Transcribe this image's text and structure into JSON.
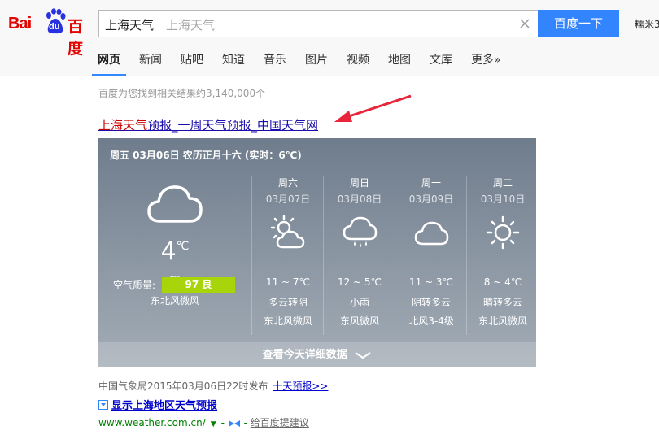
{
  "header": {
    "logo_left": "Bai",
    "logo_du": "du",
    "logo_cn": "百度",
    "search_value": "上海天气",
    "search_suggest": "上海天气",
    "search_button": "百度一下",
    "user_link": "糯米3"
  },
  "nav": [
    {
      "label": "网页",
      "active": true
    },
    {
      "label": "新闻"
    },
    {
      "label": "贴吧"
    },
    {
      "label": "知道"
    },
    {
      "label": "音乐"
    },
    {
      "label": "图片"
    },
    {
      "label": "视频"
    },
    {
      "label": "地图"
    },
    {
      "label": "文库"
    },
    {
      "label": "更多»"
    }
  ],
  "result_count": "百度为您找到相关结果约3,140,000个",
  "result": {
    "title_highlight": "上海天气",
    "title_rest": "预报_一周天气预报_中国天气网"
  },
  "weather": {
    "date_line": "周五 03月06日 农历正月十六 (实时：6℃)",
    "today": {
      "temp": "4",
      "unit": "℃",
      "condition": "阴",
      "wind": "东北风微风",
      "aqi_label": "空气质量:",
      "aqi_value": "97 良",
      "icon": "cloud-icon"
    },
    "days": [
      {
        "name": "周六",
        "date": "03月07日",
        "range": "11 ~ 7℃",
        "cond": "多云转阴",
        "wind": "东北风微风",
        "icon": "sun-cloud-icon"
      },
      {
        "name": "周日",
        "date": "03月08日",
        "range": "12 ~ 5℃",
        "cond": "小雨",
        "wind": "东风微风",
        "icon": "rain-cloud-icon"
      },
      {
        "name": "周一",
        "date": "03月09日",
        "range": "11 ~ 3℃",
        "cond": "阴转多云",
        "wind": "北风3-4级",
        "icon": "cloud-icon"
      },
      {
        "name": "周二",
        "date": "03月10日",
        "range": "8 ~ 4℃",
        "cond": "晴转多云",
        "wind": "东北风微风",
        "icon": "sun-icon"
      }
    ],
    "detail_label": "查看今天详细数据"
  },
  "source": {
    "text": "中国气象局2015年03月06日22时发布",
    "ten_day": "十天预报>>"
  },
  "show_local": "显示上海地区天气预报",
  "url": {
    "domain": "www.weather.com.cn/",
    "feedback": "给百度提建议"
  },
  "colors": {
    "brand_red": "#e10602",
    "brand_blue": "#2932e1",
    "search_button": "#3385ff",
    "aqi_good": "#a8d40a"
  }
}
